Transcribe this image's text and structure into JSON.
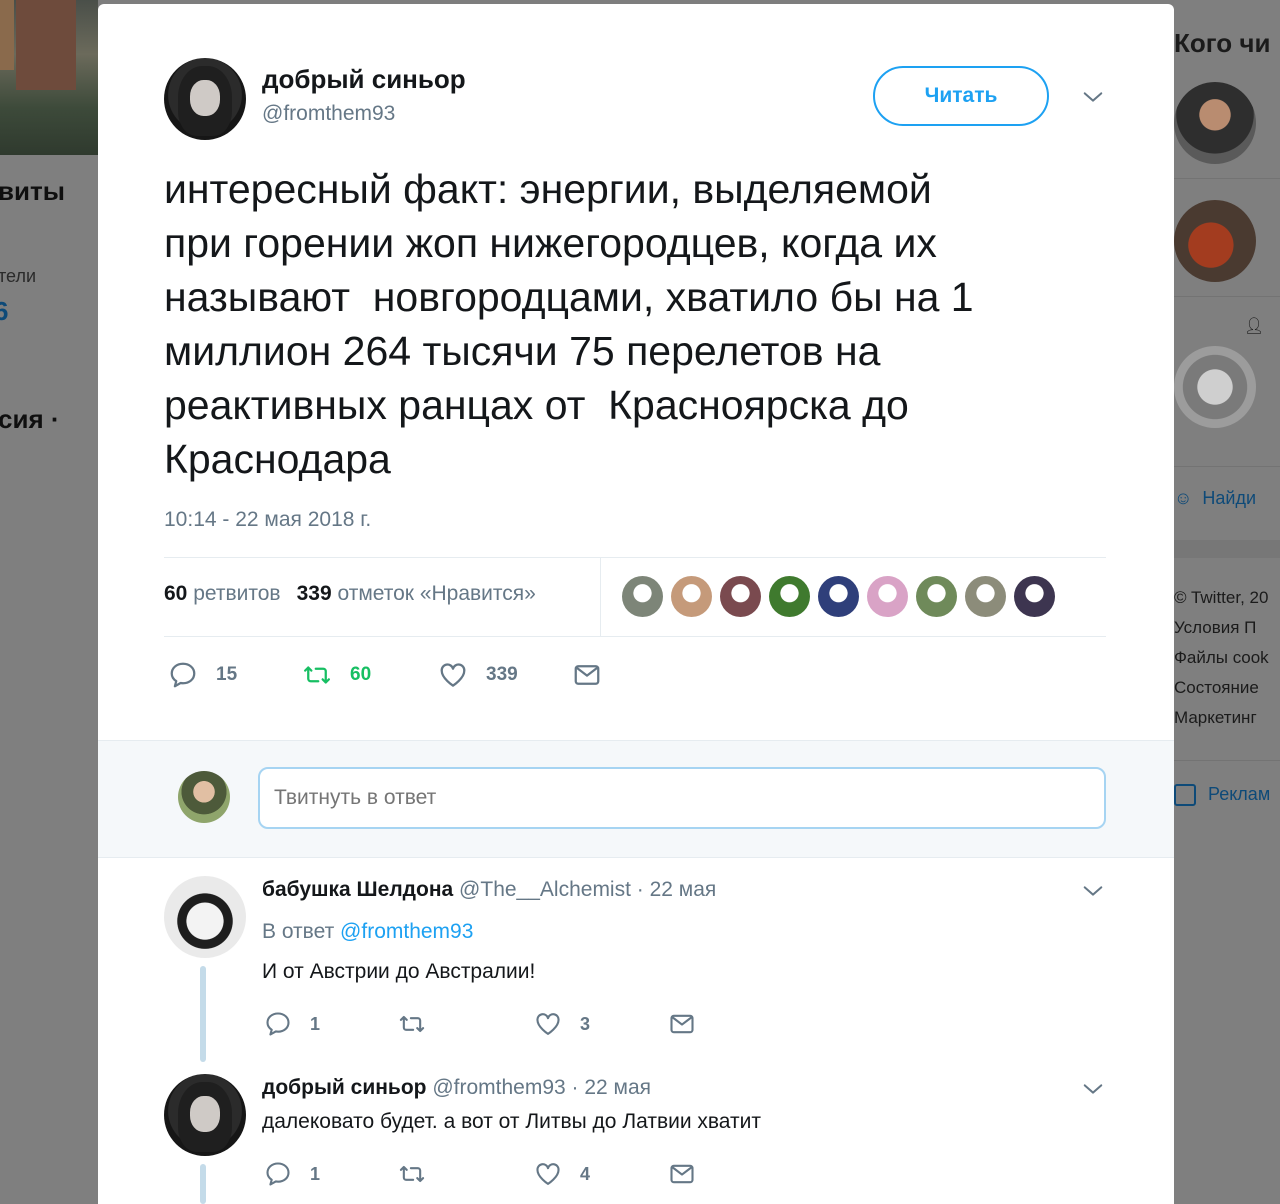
{
  "background": {
    "left_texts": [
      "виты",
      "тели",
      "6",
      "сия ·"
    ],
    "right_title": "Кого чи",
    "right_find": "Найди",
    "right_footer": [
      "© Twitter, 20",
      "Условия  П",
      "Файлы cook",
      "Состояние",
      "Маркетинг"
    ],
    "right_ads": "Реклам"
  },
  "tweet": {
    "display_name": "добрый синьор",
    "handle": "@fromthem93",
    "follow_label": "Читать",
    "text": "интересный факт: энергии, выделяемой\nпри горении жоп нижегородцев, когда их\nназывают  новгородцами, хватило бы на 1\nмиллион 264 тысячи 75 перелетов на\nреактивных ранцах от  Красноярска до\nКраснодара",
    "timestamp": "10:14 - 22 мая 2018 г.",
    "retweets_count": "60",
    "retweets_label": "ретвитов",
    "likes_count": "339",
    "likes_label": "отметок «Нравится»",
    "likers_colors": [
      "#7d8578",
      "#c59a7a",
      "#7a4a4f",
      "#3f7a2e",
      "#2f3f7a",
      "#d9a3c6",
      "#6f8a5a",
      "#8c8c7a",
      "#3d3550"
    ],
    "actions": {
      "replies": "15",
      "retweets": "60",
      "likes": "339"
    }
  },
  "reply_box": {
    "placeholder": "Твитнуть в ответ"
  },
  "replies": [
    {
      "name": "бабушка Шелдона",
      "meta": "@The__Alchemist · 22 мая",
      "in_reply_prefix": "В ответ",
      "in_reply_handle": "@fromthem93",
      "text": "И от Австрии до Австралии!",
      "replies": "1",
      "retweets": "",
      "likes": "3"
    },
    {
      "name": "добрый синьор",
      "meta": "@fromthem93 · 22 мая",
      "text": "далековато будет. а вот от Литвы до Латвии хватит",
      "replies": "1",
      "retweets": "",
      "likes": "4"
    }
  ]
}
